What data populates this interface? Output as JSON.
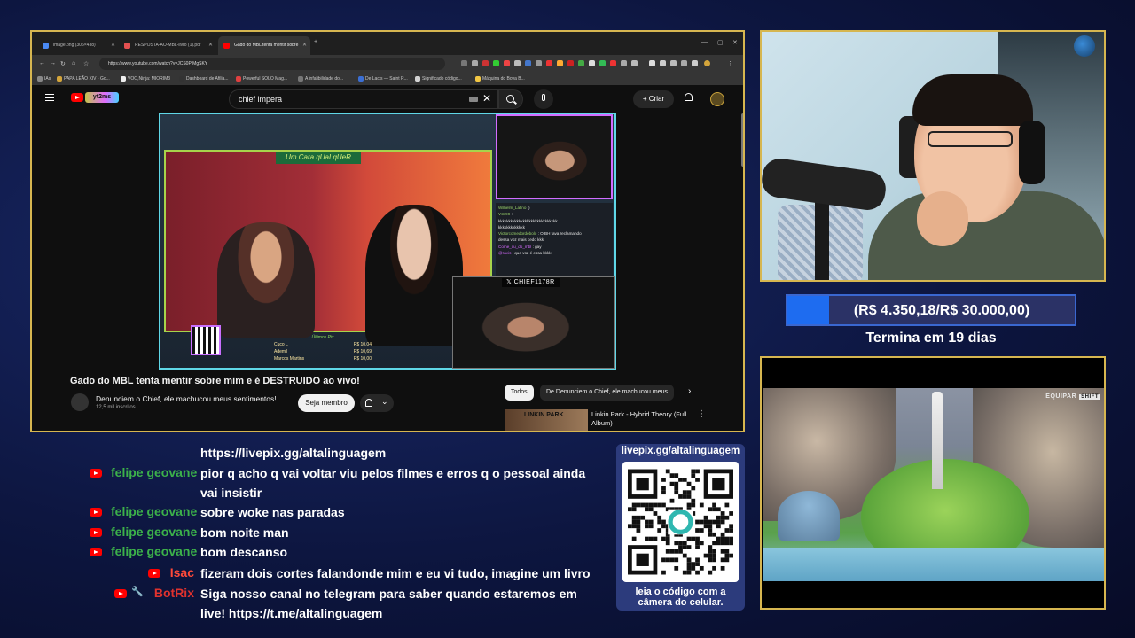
{
  "browser": {
    "tabs": [
      {
        "label": "image.png (306×438)",
        "color": "#4a8af4",
        "active": false
      },
      {
        "label": "RESPOSTA-AO-MBL-livro (1).pdf",
        "color": "#e35050",
        "active": false
      },
      {
        "label": "Gado do MBL tenta mentir sobre",
        "color": "#ff0000",
        "active": true
      }
    ],
    "url": "https://www.youtube.com/watch?v=JCS0PtMgSKY",
    "bookmarks": [
      {
        "label": "IAs",
        "color": "#888888"
      },
      {
        "label": "PAPA LEÃO XIV - Go...",
        "color": "#d4a53b"
      },
      {
        "label": "VOO,Ninja: MIORIM3",
        "color": "#eeeeee"
      },
      {
        "label": "Dashboard de Afilia...",
        "color": "#333333"
      },
      {
        "label": "Powerful SOLO Mag...",
        "color": "#e04040"
      },
      {
        "label": "A infalibilidade do...",
        "color": "#777777"
      },
      {
        "label": "De Lacis — Saint R...",
        "color": "#3b6fd4"
      },
      {
        "label": "Significado código...",
        "color": "#d4d4d4"
      },
      {
        "label": "Máquina do Bova B...",
        "color": "#f2c744"
      }
    ]
  },
  "youtube": {
    "logo_text": "yt2ms",
    "search_query": "chief impera",
    "create_label": "Criar",
    "video": {
      "banner": "Um Cara qUaLqUeR",
      "overlay_label": "CHIEF1178R",
      "mini_chat": [
        {
          "name": "Wilhelm_Latino",
          "msg": ":)",
          "np": false
        },
        {
          "name": "Vstr99",
          "msg": ":",
          "np": false
        },
        {
          "name": "",
          "msg": "kkkkkkkkkkkkkkkkkkkkkkkkkkkkk",
          "np": false
        },
        {
          "name": "",
          "msg": "kkkkkkkkkkkkk",
          "np": false
        },
        {
          "name": "Victorcomedordebolo",
          "msg": ": O BH tava reclamando",
          "np": false
        },
        {
          "name": "",
          "msg": "dessa voz mais cedo kkk",
          "np": false
        },
        {
          "name": "Come_cu_do_mbl",
          "msg": ": gay",
          "np": true
        },
        {
          "name": "@ravis",
          "msg": ": que voz é essa kkkk",
          "np": true
        }
      ],
      "donors_title": "Últimos Pix",
      "donors": [
        {
          "name": "Cuco L",
          "amount": "R$ 10,04"
        },
        {
          "name": "Ademil",
          "amount": "R$ 10,69"
        },
        {
          "name": "Marcos Martins",
          "amount": "R$ 10,00"
        }
      ]
    },
    "title": "Gado do MBL tenta mentir sobre mim e é DESTRUIDO ao vivo!",
    "channel_name": "Denunciem o Chief, ele machucou meus sentimentos!",
    "subscribers": "12,5 mil inscritos",
    "join_label": "Seja membro",
    "chips": [
      "Todos",
      "De Denunciem o Chief, ele machucou meus"
    ],
    "recommendation": {
      "thumb_text": "LINKIN PARK",
      "title": "Linkin Park - Hybrid Theory (Full Album)"
    }
  },
  "goal": {
    "text": "(R$ 4.350,18/R$ 30.000,00)",
    "progress": 0.145,
    "subtitle": "Termina em 19 dias"
  },
  "game": {
    "hud_label": "EQUIPAR",
    "hud_key": "SHIFT"
  },
  "chat": [
    {
      "name": "",
      "color": "",
      "message": "https://livepix.gg/altalinguagem",
      "bot": false,
      "badge": false
    },
    {
      "name": "felipe geovane",
      "color": "#3cb14a",
      "message": "pior q acho q vai voltar viu pelos filmes e erros q o pessoal ainda vai insistir",
      "bot": false,
      "badge": true
    },
    {
      "name": "felipe geovane",
      "color": "#3cb14a",
      "message": "sobre woke nas paradas",
      "bot": false,
      "badge": true
    },
    {
      "name": "felipe geovane",
      "color": "#3cb14a",
      "message": "bom noite man",
      "bot": false,
      "badge": true
    },
    {
      "name": "felipe geovane",
      "color": "#3cb14a",
      "message": "bom descanso",
      "bot": false,
      "badge": true
    },
    {
      "name": "Isac",
      "color": "#ff4a3a",
      "message": "fizeram dois cortes falandonde mim e eu vi tudo, imagine um livro",
      "bot": false,
      "badge": true
    },
    {
      "name": "BotRix",
      "color": "#e0322e",
      "message": "Siga nosso canal no telegram para saber quando estaremos em live! https://t.me/altalinguagem",
      "bot": true,
      "badge": true
    }
  ],
  "qr": {
    "top": "livepix.gg/altalinguagem",
    "bottom_line1": "leia o código com a",
    "bottom_line2": "câmera do celular."
  }
}
